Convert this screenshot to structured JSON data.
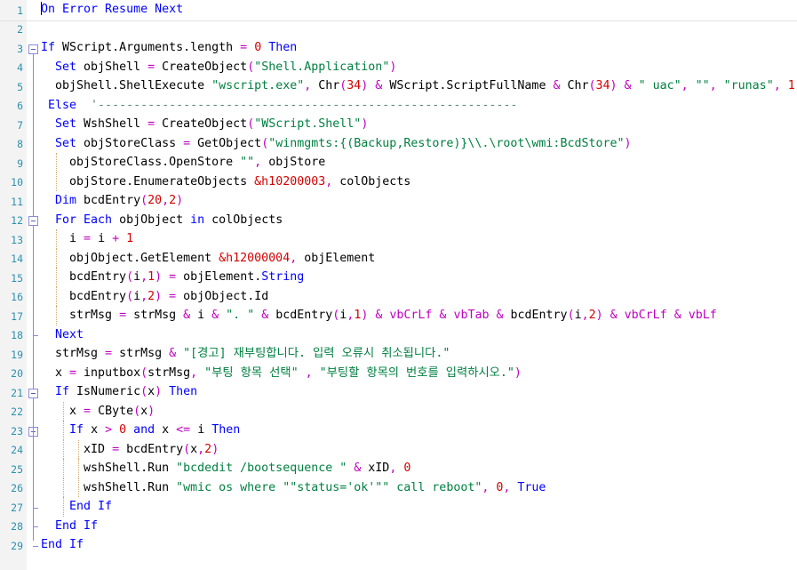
{
  "editor": {
    "name": "code-editor",
    "language": "VBScript",
    "line_count": 29,
    "colors": {
      "background": "#ffffff",
      "gutter_background": "#f3f3f3",
      "line_number": "#2b91af",
      "keyword": "#0000ff",
      "string": "#008040",
      "number": "#d40000",
      "operator": "#c000c0",
      "comment": "#5c8a78",
      "constant": "#c000c0",
      "plain": "#000000",
      "fold_marker": "#8b8bd8",
      "indent_guide": "#d4a96a"
    },
    "line_numbers": [
      "1",
      "2",
      "3",
      "4",
      "5",
      "6",
      "7",
      "8",
      "9",
      "10",
      "11",
      "12",
      "13",
      "14",
      "15",
      "16",
      "17",
      "18",
      "19",
      "20",
      "21",
      "22",
      "23",
      "24",
      "25",
      "26",
      "27",
      "28",
      "29"
    ],
    "fold_markers": [
      {
        "line": 3,
        "type": "collapse-box"
      },
      {
        "line": 12,
        "type": "collapse-box"
      },
      {
        "line": 18,
        "type": "tick"
      },
      {
        "line": 21,
        "type": "collapse-box"
      },
      {
        "line": 23,
        "type": "collapse-box"
      },
      {
        "line": 27,
        "type": "tick"
      },
      {
        "line": 28,
        "type": "tick"
      },
      {
        "line": 29,
        "type": "end"
      }
    ],
    "lines": [
      {
        "n": 1,
        "indent_guides": [],
        "tokens": [
          {
            "t": "caret",
            "v": ""
          },
          {
            "t": "kw",
            "v": "On Error Resume Next"
          }
        ]
      },
      {
        "n": 2,
        "indent_guides": [],
        "tokens": []
      },
      {
        "n": 3,
        "indent_guides": [],
        "tokens": [
          {
            "t": "kw",
            "v": "If "
          },
          {
            "t": "pln",
            "v": "WScript.Arguments.length "
          },
          {
            "t": "op",
            "v": "= "
          },
          {
            "t": "num",
            "v": "0"
          },
          {
            "t": "pln",
            "v": " "
          },
          {
            "t": "kw",
            "v": "Then"
          }
        ]
      },
      {
        "n": 4,
        "indent_guides": [],
        "tokens": [
          {
            "t": "pln",
            "v": "  "
          },
          {
            "t": "kw",
            "v": "Set "
          },
          {
            "t": "pln",
            "v": "objShell "
          },
          {
            "t": "op",
            "v": "= "
          },
          {
            "t": "pln",
            "v": "CreateObject"
          },
          {
            "t": "op",
            "v": "("
          },
          {
            "t": "str",
            "v": "\"Shell.Application\""
          },
          {
            "t": "op",
            "v": ")"
          }
        ]
      },
      {
        "n": 5,
        "indent_guides": [],
        "tokens": [
          {
            "t": "pln",
            "v": "  objShell.ShellExecute "
          },
          {
            "t": "str",
            "v": "\"wscript.exe\""
          },
          {
            "t": "op",
            "v": ", "
          },
          {
            "t": "pln",
            "v": "Chr"
          },
          {
            "t": "op",
            "v": "("
          },
          {
            "t": "num",
            "v": "34"
          },
          {
            "t": "op",
            "v": ") & "
          },
          {
            "t": "pln",
            "v": "WScript.ScriptFullName "
          },
          {
            "t": "op",
            "v": "& "
          },
          {
            "t": "pln",
            "v": "Chr"
          },
          {
            "t": "op",
            "v": "("
          },
          {
            "t": "num",
            "v": "34"
          },
          {
            "t": "op",
            "v": ") & "
          },
          {
            "t": "str",
            "v": "\" uac\""
          },
          {
            "t": "op",
            "v": ", "
          },
          {
            "t": "str",
            "v": "\"\""
          },
          {
            "t": "op",
            "v": ", "
          },
          {
            "t": "str",
            "v": "\"runas\""
          },
          {
            "t": "op",
            "v": ", "
          },
          {
            "t": "num",
            "v": "1"
          }
        ]
      },
      {
        "n": 6,
        "indent_guides": [],
        "tokens": [
          {
            "t": "kw",
            "v": " Else"
          },
          {
            "t": "pln",
            "v": "  "
          },
          {
            "t": "cmt",
            "v": "'-----------------------------------------------------------"
          }
        ]
      },
      {
        "n": 7,
        "indent_guides": [],
        "tokens": [
          {
            "t": "pln",
            "v": "  "
          },
          {
            "t": "kw",
            "v": "Set "
          },
          {
            "t": "pln",
            "v": "WshShell "
          },
          {
            "t": "op",
            "v": "= "
          },
          {
            "t": "pln",
            "v": "CreateObject"
          },
          {
            "t": "op",
            "v": "("
          },
          {
            "t": "str",
            "v": "\"WScript.Shell\""
          },
          {
            "t": "op",
            "v": ")"
          }
        ]
      },
      {
        "n": 8,
        "indent_guides": [],
        "tokens": [
          {
            "t": "pln",
            "v": "  "
          },
          {
            "t": "kw",
            "v": "Set "
          },
          {
            "t": "pln",
            "v": "objStoreClass "
          },
          {
            "t": "op",
            "v": "= "
          },
          {
            "t": "pln",
            "v": "GetObject"
          },
          {
            "t": "op",
            "v": "("
          },
          {
            "t": "str",
            "v": "\"winmgmts:{(Backup,Restore)}\\\\.\\root\\wmi:BcdStore\""
          },
          {
            "t": "op",
            "v": ")"
          }
        ]
      },
      {
        "n": 9,
        "indent_guides": [
          2
        ],
        "tokens": [
          {
            "t": "pln",
            "v": "    objStoreClass.OpenStore "
          },
          {
            "t": "str",
            "v": "\"\""
          },
          {
            "t": "op",
            "v": ", "
          },
          {
            "t": "pln",
            "v": "objStore"
          }
        ]
      },
      {
        "n": 10,
        "indent_guides": [
          2
        ],
        "tokens": [
          {
            "t": "pln",
            "v": "    objStore.EnumerateObjects "
          },
          {
            "t": "num",
            "v": "&h10200003"
          },
          {
            "t": "op",
            "v": ", "
          },
          {
            "t": "pln",
            "v": "colObjects"
          }
        ]
      },
      {
        "n": 11,
        "indent_guides": [],
        "tokens": [
          {
            "t": "pln",
            "v": "  "
          },
          {
            "t": "kw",
            "v": "Dim "
          },
          {
            "t": "pln",
            "v": "bcdEntry"
          },
          {
            "t": "op",
            "v": "("
          },
          {
            "t": "num",
            "v": "20"
          },
          {
            "t": "op",
            "v": ","
          },
          {
            "t": "num",
            "v": "2"
          },
          {
            "t": "op",
            "v": ")"
          }
        ]
      },
      {
        "n": 12,
        "indent_guides": [],
        "tokens": [
          {
            "t": "pln",
            "v": "  "
          },
          {
            "t": "kw",
            "v": "For Each "
          },
          {
            "t": "pln",
            "v": "objObject "
          },
          {
            "t": "kw",
            "v": "in "
          },
          {
            "t": "pln",
            "v": "colObjects"
          }
        ]
      },
      {
        "n": 13,
        "indent_guides": [
          2
        ],
        "tokens": [
          {
            "t": "pln",
            "v": "    i "
          },
          {
            "t": "op",
            "v": "= "
          },
          {
            "t": "pln",
            "v": "i "
          },
          {
            "t": "op",
            "v": "+ "
          },
          {
            "t": "num",
            "v": "1"
          }
        ]
      },
      {
        "n": 14,
        "indent_guides": [
          2
        ],
        "tokens": [
          {
            "t": "pln",
            "v": "    objObject.GetElement "
          },
          {
            "t": "num",
            "v": "&h12000004"
          },
          {
            "t": "op",
            "v": ", "
          },
          {
            "t": "pln",
            "v": "objElement"
          }
        ]
      },
      {
        "n": 15,
        "indent_guides": [
          2
        ],
        "tokens": [
          {
            "t": "pln",
            "v": "    bcdEntry"
          },
          {
            "t": "op",
            "v": "("
          },
          {
            "t": "pln",
            "v": "i"
          },
          {
            "t": "op",
            "v": ","
          },
          {
            "t": "num",
            "v": "1"
          },
          {
            "t": "op",
            "v": ") = "
          },
          {
            "t": "pln",
            "v": "objElement."
          },
          {
            "t": "kw",
            "v": "String"
          }
        ]
      },
      {
        "n": 16,
        "indent_guides": [
          2
        ],
        "tokens": [
          {
            "t": "pln",
            "v": "    bcdEntry"
          },
          {
            "t": "op",
            "v": "("
          },
          {
            "t": "pln",
            "v": "i"
          },
          {
            "t": "op",
            "v": ","
          },
          {
            "t": "num",
            "v": "2"
          },
          {
            "t": "op",
            "v": ") = "
          },
          {
            "t": "pln",
            "v": "objObject.Id"
          }
        ]
      },
      {
        "n": 17,
        "indent_guides": [
          2
        ],
        "tokens": [
          {
            "t": "pln",
            "v": "    strMsg "
          },
          {
            "t": "op",
            "v": "= "
          },
          {
            "t": "pln",
            "v": "strMsg "
          },
          {
            "t": "op",
            "v": "& "
          },
          {
            "t": "pln",
            "v": "i "
          },
          {
            "t": "op",
            "v": "& "
          },
          {
            "t": "str",
            "v": "\". \""
          },
          {
            "t": "op",
            "v": " & "
          },
          {
            "t": "pln",
            "v": "bcdEntry"
          },
          {
            "t": "op",
            "v": "("
          },
          {
            "t": "pln",
            "v": "i"
          },
          {
            "t": "op",
            "v": ","
          },
          {
            "t": "num",
            "v": "1"
          },
          {
            "t": "op",
            "v": ") & "
          },
          {
            "t": "cst",
            "v": "vbCrLf"
          },
          {
            "t": "op",
            "v": " & "
          },
          {
            "t": "cst",
            "v": "vbTab"
          },
          {
            "t": "op",
            "v": " & "
          },
          {
            "t": "pln",
            "v": "bcdEntry"
          },
          {
            "t": "op",
            "v": "("
          },
          {
            "t": "pln",
            "v": "i"
          },
          {
            "t": "op",
            "v": ","
          },
          {
            "t": "num",
            "v": "2"
          },
          {
            "t": "op",
            "v": ") & "
          },
          {
            "t": "cst",
            "v": "vbCrLf"
          },
          {
            "t": "op",
            "v": " & "
          },
          {
            "t": "cst",
            "v": "vbLf"
          }
        ]
      },
      {
        "n": 18,
        "indent_guides": [],
        "tokens": [
          {
            "t": "pln",
            "v": "  "
          },
          {
            "t": "kw",
            "v": "Next"
          }
        ]
      },
      {
        "n": 19,
        "indent_guides": [],
        "tokens": [
          {
            "t": "pln",
            "v": "  strMsg "
          },
          {
            "t": "op",
            "v": "= "
          },
          {
            "t": "pln",
            "v": "strMsg "
          },
          {
            "t": "op",
            "v": "& "
          },
          {
            "t": "str",
            "v": "\"[경고] 재부팅합니다. 입력 오류시 취소됩니다.\""
          }
        ]
      },
      {
        "n": 20,
        "indent_guides": [],
        "tokens": [
          {
            "t": "pln",
            "v": "  x "
          },
          {
            "t": "op",
            "v": "= "
          },
          {
            "t": "pln",
            "v": "inputbox"
          },
          {
            "t": "op",
            "v": "("
          },
          {
            "t": "pln",
            "v": "strMsg"
          },
          {
            "t": "op",
            "v": ", "
          },
          {
            "t": "str",
            "v": "\"부팅 항목 선택\""
          },
          {
            "t": "op",
            "v": " , "
          },
          {
            "t": "str",
            "v": "\"부팅할 항목의 번호를 입력하시오.\""
          },
          {
            "t": "op",
            "v": ")"
          }
        ]
      },
      {
        "n": 21,
        "indent_guides": [],
        "tokens": [
          {
            "t": "pln",
            "v": "  "
          },
          {
            "t": "kw",
            "v": "If "
          },
          {
            "t": "pln",
            "v": "IsNumeric"
          },
          {
            "t": "op",
            "v": "("
          },
          {
            "t": "pln",
            "v": "x"
          },
          {
            "t": "op",
            "v": ") "
          },
          {
            "t": "kw",
            "v": "Then"
          }
        ]
      },
      {
        "n": 22,
        "indent_guides": [
          3
        ],
        "tokens": [
          {
            "t": "pln",
            "v": "    x "
          },
          {
            "t": "op",
            "v": "= "
          },
          {
            "t": "pln",
            "v": "CByte"
          },
          {
            "t": "op",
            "v": "("
          },
          {
            "t": "pln",
            "v": "x"
          },
          {
            "t": "op",
            "v": ")"
          }
        ]
      },
      {
        "n": 23,
        "indent_guides": [
          3
        ],
        "tokens": [
          {
            "t": "pln",
            "v": "    "
          },
          {
            "t": "kw",
            "v": "If "
          },
          {
            "t": "pln",
            "v": "x "
          },
          {
            "t": "op",
            "v": "> "
          },
          {
            "t": "num",
            "v": "0"
          },
          {
            "t": "pln",
            "v": " "
          },
          {
            "t": "kw",
            "v": "and "
          },
          {
            "t": "pln",
            "v": "x "
          },
          {
            "t": "op",
            "v": "<= "
          },
          {
            "t": "pln",
            "v": "i "
          },
          {
            "t": "kw",
            "v": "Then"
          }
        ]
      },
      {
        "n": 24,
        "indent_guides": [
          3,
          5
        ],
        "tokens": [
          {
            "t": "pln",
            "v": "      xID "
          },
          {
            "t": "op",
            "v": "= "
          },
          {
            "t": "pln",
            "v": "bcdEntry"
          },
          {
            "t": "op",
            "v": "("
          },
          {
            "t": "pln",
            "v": "x"
          },
          {
            "t": "op",
            "v": ","
          },
          {
            "t": "num",
            "v": "2"
          },
          {
            "t": "op",
            "v": ")"
          }
        ]
      },
      {
        "n": 25,
        "indent_guides": [
          3,
          5
        ],
        "tokens": [
          {
            "t": "pln",
            "v": "      wshShell.Run "
          },
          {
            "t": "str",
            "v": "\"bcdedit /bootsequence \""
          },
          {
            "t": "op",
            "v": " & "
          },
          {
            "t": "pln",
            "v": "xID"
          },
          {
            "t": "op",
            "v": ", "
          },
          {
            "t": "num",
            "v": "0"
          }
        ]
      },
      {
        "n": 26,
        "indent_guides": [
          3,
          5
        ],
        "tokens": [
          {
            "t": "pln",
            "v": "      wshShell.Run "
          },
          {
            "t": "str",
            "v": "\"wmic os where \"\"status='ok'\"\" call reboot\""
          },
          {
            "t": "op",
            "v": ", "
          },
          {
            "t": "num",
            "v": "0"
          },
          {
            "t": "op",
            "v": ", "
          },
          {
            "t": "kw",
            "v": "True"
          }
        ]
      },
      {
        "n": 27,
        "indent_guides": [
          3
        ],
        "tokens": [
          {
            "t": "pln",
            "v": "    "
          },
          {
            "t": "kw",
            "v": "End If"
          }
        ]
      },
      {
        "n": 28,
        "indent_guides": [],
        "tokens": [
          {
            "t": "pln",
            "v": "  "
          },
          {
            "t": "kw",
            "v": "End If"
          }
        ]
      },
      {
        "n": 29,
        "indent_guides": [],
        "tokens": [
          {
            "t": "kw",
            "v": "End If"
          }
        ]
      }
    ]
  }
}
